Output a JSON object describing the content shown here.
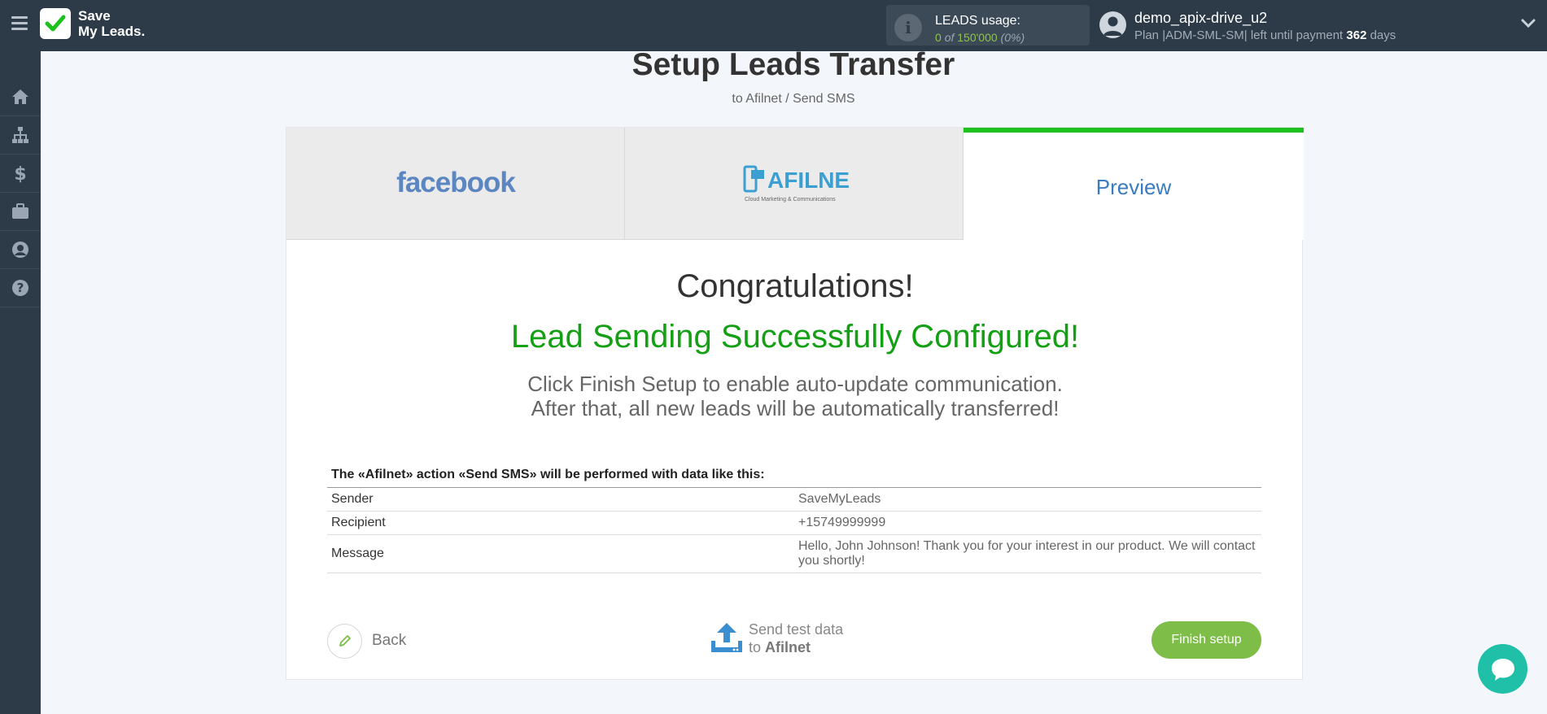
{
  "header": {
    "logo_line1": "Save",
    "logo_line2": "My Leads.",
    "usage_title": "LEADS usage:",
    "usage_used": "0",
    "usage_of": "of",
    "usage_total": "150'000",
    "usage_pct": "(0%)",
    "user_name": "demo_apix-drive_u2",
    "plan_prefix": "Plan |ADM-SML-SM| left until payment",
    "plan_days": "362",
    "plan_suffix": "days"
  },
  "sidebar": {
    "items": [
      {
        "icon": "home-icon"
      },
      {
        "icon": "sitemap-icon"
      },
      {
        "icon": "dollar-icon"
      },
      {
        "icon": "briefcase-icon"
      },
      {
        "icon": "user-icon"
      },
      {
        "icon": "help-icon"
      }
    ]
  },
  "page": {
    "title": "Setup Leads Transfer",
    "subtitle": "to Afilnet / Send SMS"
  },
  "tabs": {
    "facebook_label": "facebook",
    "afilnet_label": "AFILNET",
    "afilnet_tagline": "Cloud Marketing & Communications",
    "preview_label": "Preview"
  },
  "result": {
    "congrats": "Congratulations!",
    "success": "Lead Sending Successfully Configured!",
    "info_line1": "Click Finish Setup to enable auto-update communication.",
    "info_line2": "After that, all new leads will be automatically transferred!"
  },
  "table": {
    "caption": "The «Afilnet» action «Send SMS» will be performed with data like this:",
    "rows": [
      {
        "key": "Sender",
        "value": "SaveMyLeads"
      },
      {
        "key": "Recipient",
        "value": "+15749999999"
      },
      {
        "key": "Message",
        "value": "Hello, John Johnson! Thank you for your interest in our product. We will contact you shortly!"
      }
    ]
  },
  "actions": {
    "back_label": "Back",
    "send_test_line1": "Send test data",
    "send_test_to": "to",
    "send_test_target": "Afilnet",
    "finish_label": "Finish setup"
  },
  "colors": {
    "topbar": "#2d3a48",
    "accent_green": "#7dbd48",
    "success_green": "#14a014",
    "tab_active_border": "#1ec11e",
    "link_blue": "#3a7cc0",
    "chat": "#1fbfa8"
  }
}
